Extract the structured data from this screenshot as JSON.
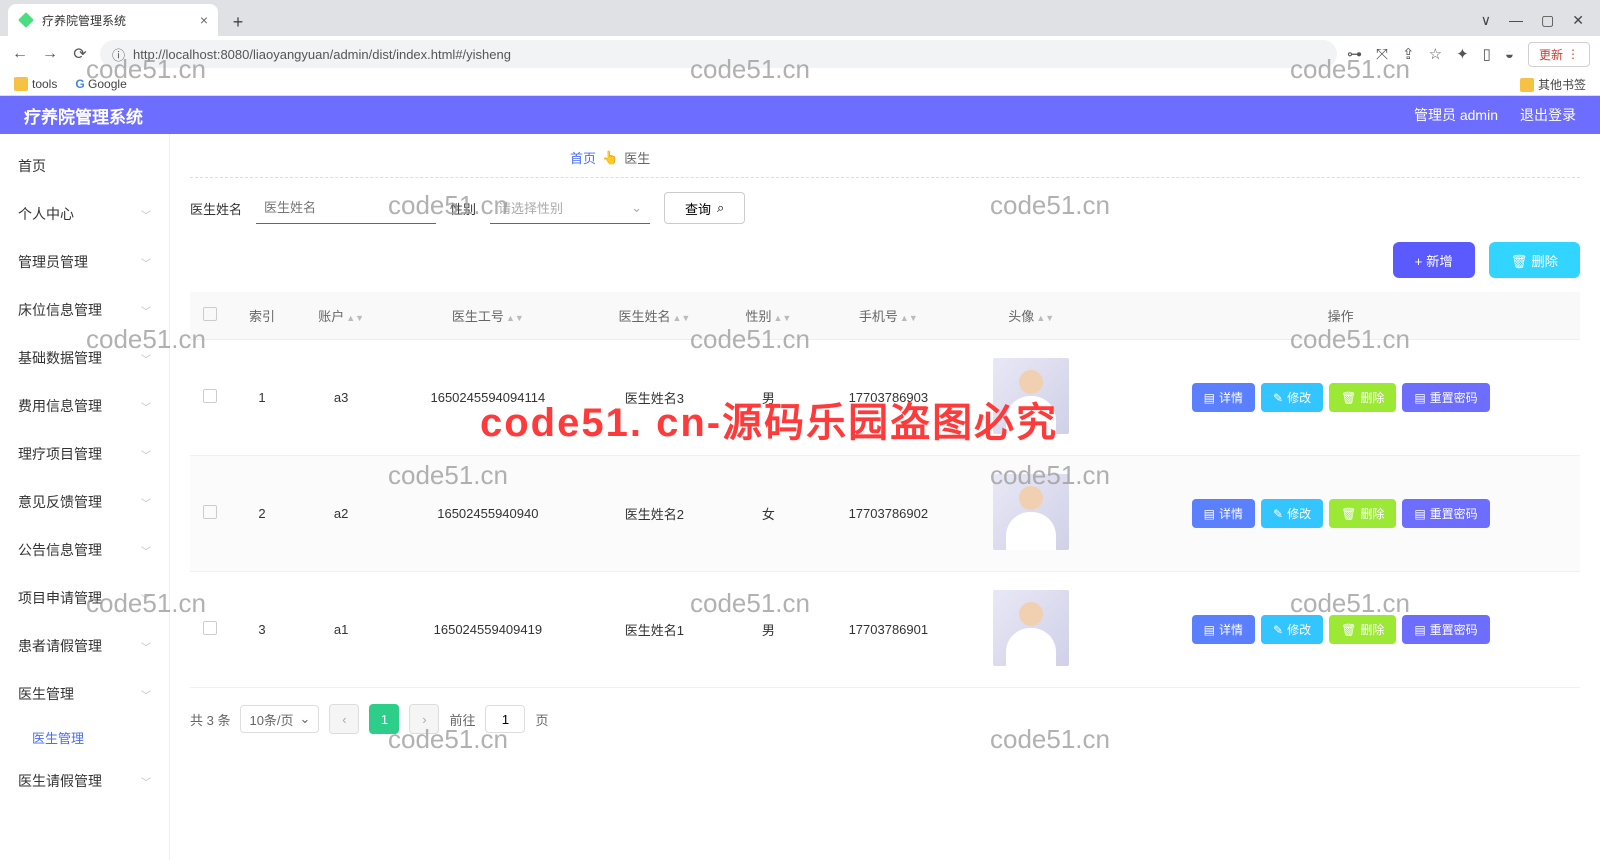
{
  "browser": {
    "tab_title": "疗养院管理系统",
    "url": "http://localhost:8080/liaoyangyuan/admin/dist/index.html#/yisheng",
    "update_btn": "更新",
    "bookmarks": {
      "tools": "tools",
      "google": "Google",
      "other": "其他书签"
    }
  },
  "header": {
    "title": "疗养院管理系统",
    "user": "管理员 admin",
    "logout": "退出登录"
  },
  "sidebar": {
    "items": [
      "首页",
      "个人中心",
      "管理员管理",
      "床位信息管理",
      "基础数据管理",
      "费用信息管理",
      "理疗项目管理",
      "意见反馈管理",
      "公告信息管理",
      "项目申请管理",
      "患者请假管理",
      "医生管理",
      "医生请假管理"
    ],
    "sub_active": "医生管理"
  },
  "breadcrumb": {
    "home": "首页",
    "sep": "👆",
    "current": "医生"
  },
  "search": {
    "name_label": "医生姓名",
    "name_ph": "医生姓名",
    "gender_label": "性别",
    "gender_ph": "请选择性别",
    "query_btn": "查询"
  },
  "actions": {
    "add": "新增",
    "del": "删除"
  },
  "table": {
    "headers": [
      "索引",
      "账户",
      "医生工号",
      "医生姓名",
      "性别",
      "手机号",
      "头像",
      "操作"
    ],
    "rows": [
      {
        "idx": "1",
        "acct": "a3",
        "no": "1650245594094114",
        "name": "医生姓名3",
        "gender": "男",
        "phone": "17703786903"
      },
      {
        "idx": "2",
        "acct": "a2",
        "no": "16502455940940",
        "name": "医生姓名2",
        "gender": "女",
        "phone": "17703786902"
      },
      {
        "idx": "3",
        "acct": "a1",
        "no": "165024559409419",
        "name": "医生姓名1",
        "gender": "男",
        "phone": "17703786901"
      }
    ],
    "row_btns": {
      "detail": "详情",
      "edit": "修改",
      "delete": "删除",
      "reset": "重置密码"
    }
  },
  "pager": {
    "total": "共 3 条",
    "size": "10条/页",
    "cur": "1",
    "goto": "前往",
    "page_suffix": "页",
    "goto_val": "1"
  },
  "watermark": "code51.cn",
  "watermark_red": "code51. cn-源码乐园盗图必究"
}
